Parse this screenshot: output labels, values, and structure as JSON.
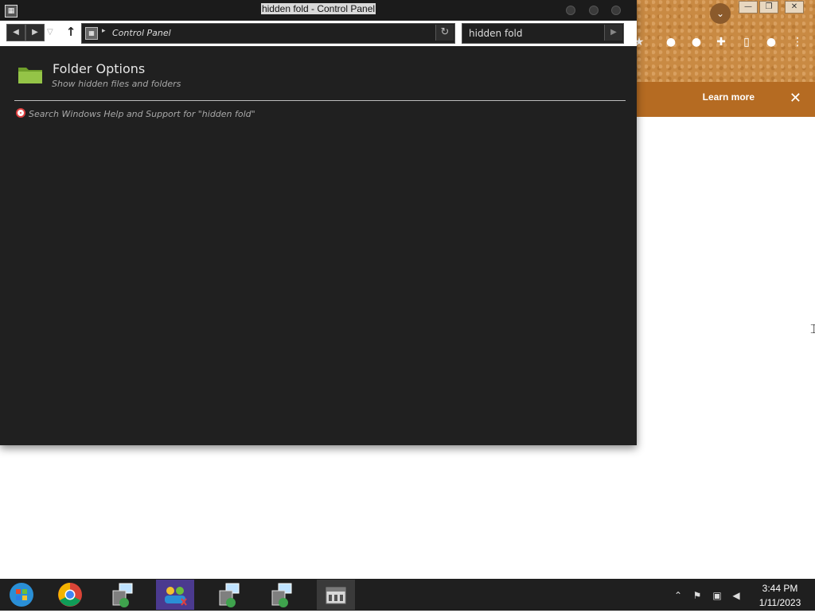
{
  "background_browser": {
    "banner_learn_more": "Learn more",
    "banner_close_glyph": "✕",
    "window_controls": [
      "—",
      "❐",
      "✕"
    ],
    "profile_glyph": "⌄"
  },
  "window": {
    "title": "hidden fold - Control Panel",
    "address": {
      "chevron": "▸",
      "path": "Control Panel"
    },
    "search": {
      "value": "hidden fold"
    }
  },
  "results": [
    {
      "title": "Folder Options",
      "description": "Show hidden files and folders"
    }
  ],
  "help_link": {
    "text": "Search Windows Help and Support for \"hidden fold\""
  },
  "taskbar": {
    "apps": [
      "start-orb-icon",
      "chrome-icon",
      "network-installer-icon",
      "users-remote-icon",
      "network-installer-icon",
      "network-installer-icon",
      "control-panel-icon"
    ],
    "clock": {
      "time": "3:44 PM",
      "date": "1/11/2023"
    }
  },
  "colors": {
    "window_bg": "#202020",
    "browser_banner": "#b56b22",
    "folder_green": "#8fbf3f",
    "taskbar_bg": "#1f1f1f"
  }
}
